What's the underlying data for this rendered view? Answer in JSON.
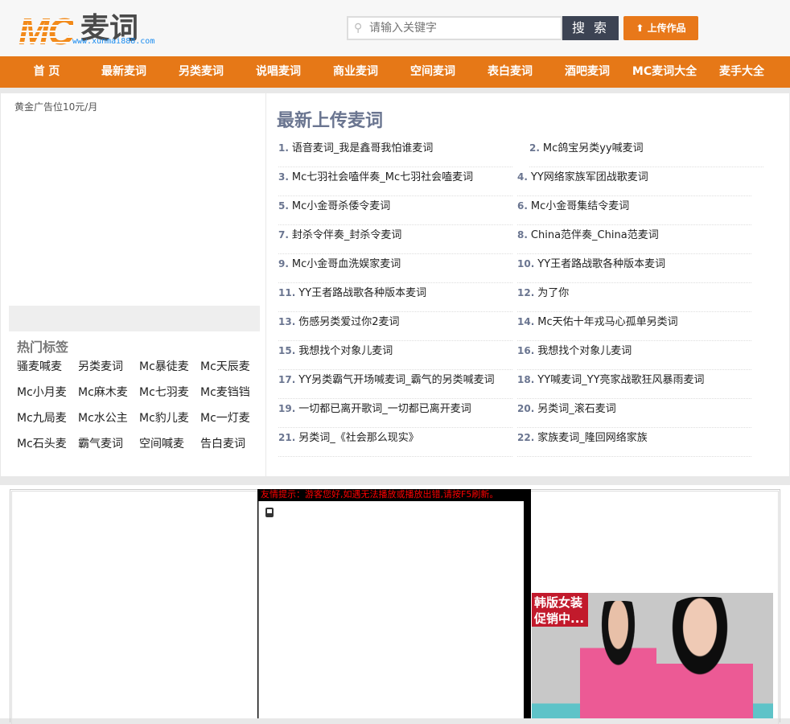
{
  "header": {
    "logo_mc": "MC",
    "logo_cn": "麦词",
    "logo_url": "www.xunmai888.com",
    "search_placeholder": "请输入关键字",
    "search_button": "搜 索",
    "upload_button": "上传作品"
  },
  "nav": [
    "首 页",
    "最新麦词",
    "另类麦词",
    "说唱麦词",
    "商业麦词",
    "空间麦词",
    "表白麦词",
    "酒吧麦词",
    "MC麦词大全",
    "麦手大全"
  ],
  "sidebar": {
    "ad_text": "黄金广告位10元/月",
    "tags_title": "热门标签",
    "tags": [
      "骚麦喊麦",
      "另类麦词",
      "Mc暴徒麦",
      "Mc天辰麦",
      "Mc小月麦",
      "Mc麻木麦",
      "Mc七羽麦",
      "Mc麦铛铛",
      "Mc九局麦",
      "Mc水公主",
      "Mc豹儿麦",
      "Mc一灯麦",
      "Mc石头麦",
      "霸气麦词",
      "空间喊麦",
      "告白麦词"
    ]
  },
  "latest": {
    "title": "最新上传麦词",
    "items": [
      {
        "n": "1.",
        "t": "语音麦词_我是鑫哥我怕谁麦词"
      },
      {
        "n": "2.",
        "t": "Mc鸽宝另类yy喊麦词"
      },
      {
        "n": "3.",
        "t": "Mc七羽社会嗑伴奏_Mc七羽社会嗑麦词"
      },
      {
        "n": "4.",
        "t": "YY网络家族军团战歌麦词"
      },
      {
        "n": "5.",
        "t": "Mc小金哥杀倭令麦词"
      },
      {
        "n": "6.",
        "t": "Mc小金哥集结令麦词"
      },
      {
        "n": "7.",
        "t": "封杀令伴奏_封杀令麦词"
      },
      {
        "n": "8.",
        "t": "China范伴奏_China范麦词"
      },
      {
        "n": "9.",
        "t": "Mc小金哥血洗娱家麦词"
      },
      {
        "n": "10.",
        "t": "YY王者路战歌各种版本麦词"
      },
      {
        "n": "11.",
        "t": "YY王者路战歌各种版本麦词"
      },
      {
        "n": "12.",
        "t": "为了你"
      },
      {
        "n": "13.",
        "t": "伤感另类爱过你2麦词"
      },
      {
        "n": "14.",
        "t": "Mc天佑十年戎马心孤单另类词"
      },
      {
        "n": "15.",
        "t": "我想找个对象儿麦词"
      },
      {
        "n": "16.",
        "t": "我想找个对象儿麦词"
      },
      {
        "n": "17.",
        "t": "YY另类霸气开场喊麦词_霸气的另类喊麦词"
      },
      {
        "n": "18.",
        "t": "YY喊麦词_YY亮家战歌狂风暴雨麦词"
      },
      {
        "n": "19.",
        "t": "一切都已离开歌词_一切都已离开麦词"
      },
      {
        "n": "20.",
        "t": "另类词_滚石麦词"
      },
      {
        "n": "21.",
        "t": "另类词_《社会那么现实》"
      },
      {
        "n": "22.",
        "t": "家族麦词_隆回网络家族"
      }
    ]
  },
  "player": {
    "tip": "友情提示：游客您好,如遇无法播放或播放出错,请按F5刷新。"
  },
  "ad": {
    "text": "韩版女装 促销中..."
  },
  "colors": {
    "accent": "#e67817",
    "title": "#6a7590",
    "tip": "#ff0000"
  }
}
